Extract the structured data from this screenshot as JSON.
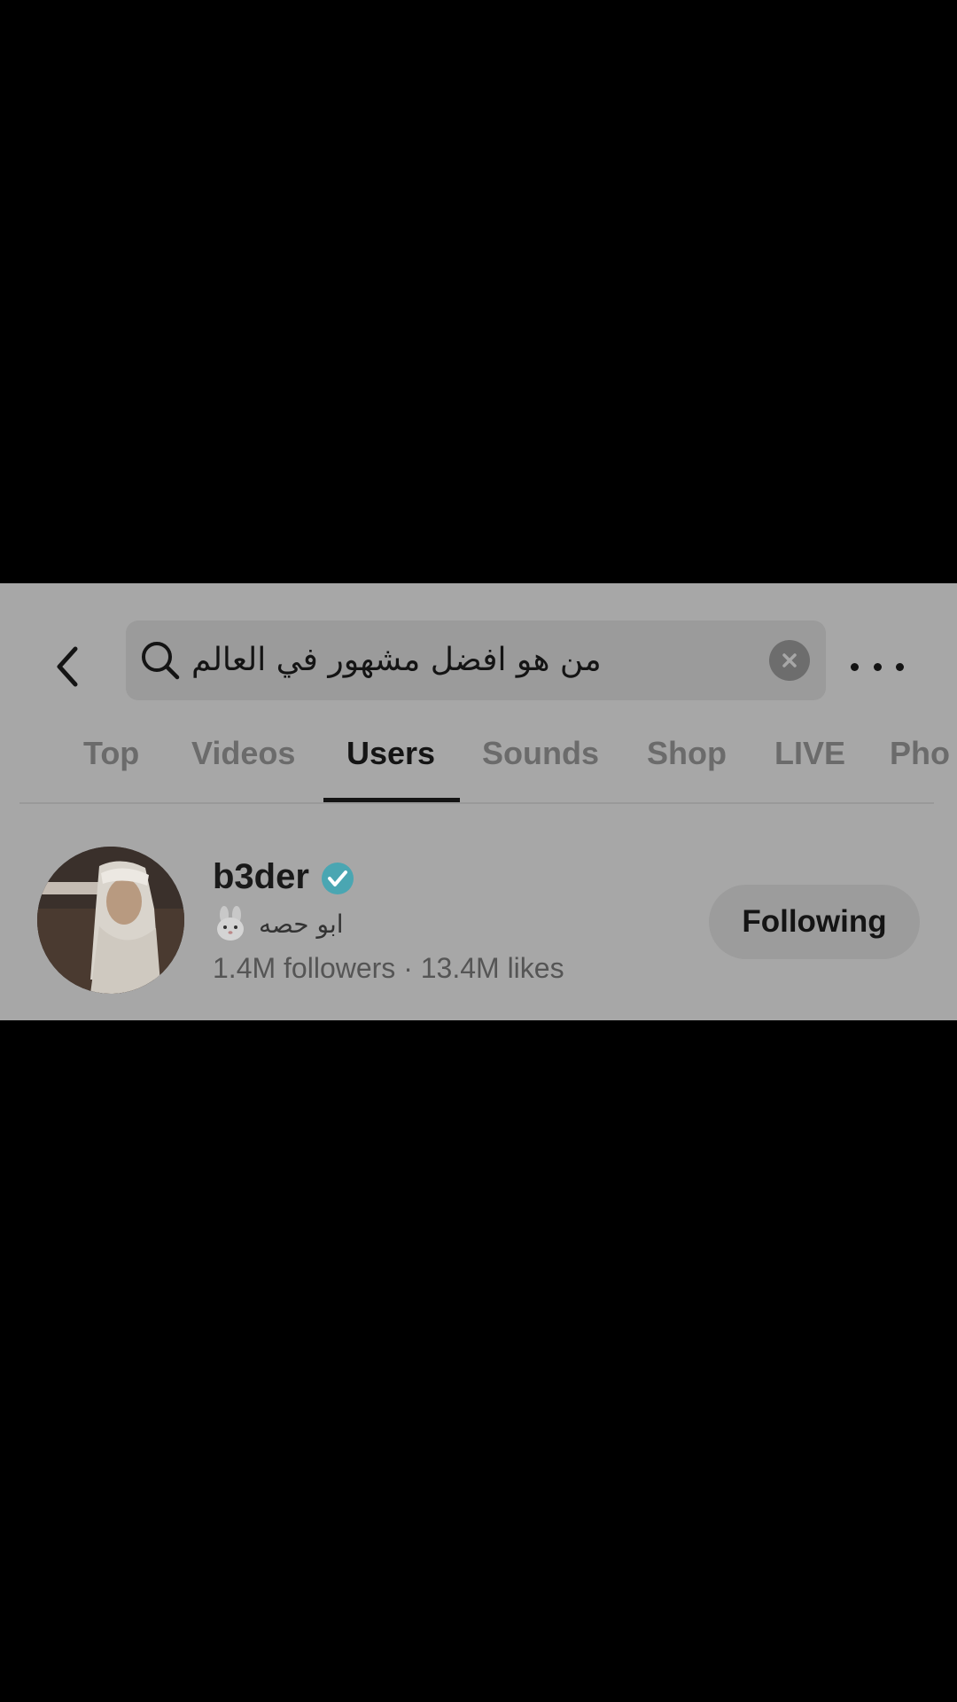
{
  "search": {
    "query": "من هو افضل مشهور في العالم"
  },
  "tabs": [
    {
      "label": "Top"
    },
    {
      "label": "Videos"
    },
    {
      "label": "Users"
    },
    {
      "label": "Sounds"
    },
    {
      "label": "Shop"
    },
    {
      "label": "LIVE"
    },
    {
      "label": "Pho"
    }
  ],
  "active_tab": "Users",
  "user": {
    "username": "b3der",
    "verified": true,
    "bio": "ابو حصه",
    "stats": "1.4M followers · 13.4M likes",
    "follow_button_label": "Following"
  },
  "icons": {
    "back": "chevron-left-icon",
    "search": "search-icon",
    "clear": "clear-icon",
    "more": "more-icon",
    "verified": "verified-badge-icon",
    "bio_emoji": "rabbit-face-icon"
  },
  "colors": {
    "background": "#000000",
    "panel": "#a7a7a7",
    "search_box": "#9b9b9b",
    "verified_badge": "#4aa6b2",
    "active_tab": "#141414",
    "inactive_tab": "#6b6b6b"
  }
}
